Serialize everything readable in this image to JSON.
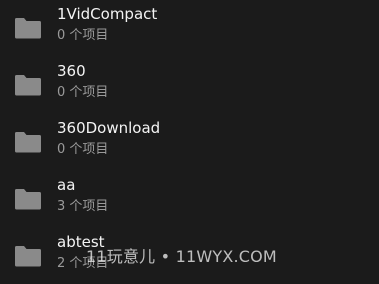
{
  "folders": [
    {
      "name": "1VidCompact",
      "count": "0 个项目",
      "icon": "folder-icon"
    },
    {
      "name": "360",
      "count": "0 个项目",
      "icon": "folder-icon"
    },
    {
      "name": "360Download",
      "count": "0 个项目",
      "icon": "folder-icon"
    },
    {
      "name": "aa",
      "count": "3 个项目",
      "icon": "folder-icon"
    },
    {
      "name": "abtest",
      "count": "2 个项目",
      "icon": "folder-icon"
    }
  ],
  "watermark": "11玩意儿 • 11WYX.COM",
  "colors": {
    "background": "#1b1b1b",
    "folder_icon": "#8a8a8a",
    "primary_text": "#f4f4f4",
    "secondary_text": "#9a9a9a"
  }
}
